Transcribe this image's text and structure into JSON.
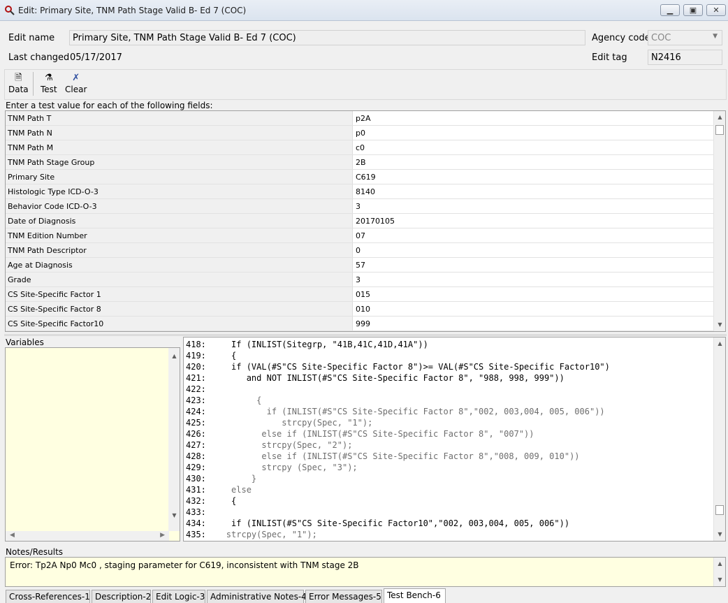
{
  "window": {
    "title": "Edit: Primary Site, TNM Path Stage Valid B- Ed 7 (COC)",
    "controls": [
      "minimize-icon",
      "maximize-icon",
      "close-icon"
    ]
  },
  "header": {
    "edit_name_label": "Edit name",
    "edit_name_value": "Primary Site, TNM Path Stage Valid B- Ed 7 (COC)",
    "agency_label": "Agency code",
    "agency_value": "COC",
    "last_changed_label": "Last changed",
    "last_changed_value": "05/17/2017",
    "edit_tag_label": "Edit tag",
    "edit_tag_value": "N2416"
  },
  "toolbar": {
    "data_label": "Data",
    "test_label": "Test",
    "clear_label": "Clear"
  },
  "prompt": "Enter a test value for each of the following fields:",
  "fields": [
    {
      "name": "TNM Path T",
      "value": "p2A"
    },
    {
      "name": "TNM Path N",
      "value": "p0"
    },
    {
      "name": "TNM Path M",
      "value": "c0"
    },
    {
      "name": "TNM Path Stage Group",
      "value": "2B"
    },
    {
      "name": "Primary Site",
      "value": "C619"
    },
    {
      "name": "Histologic Type ICD-O-3",
      "value": "8140"
    },
    {
      "name": "Behavior Code ICD-O-3",
      "value": "3"
    },
    {
      "name": "Date of Diagnosis",
      "value": "20170105"
    },
    {
      "name": "TNM Edition Number",
      "value": "07"
    },
    {
      "name": "TNM Path Descriptor",
      "value": "0"
    },
    {
      "name": "Age at Diagnosis",
      "value": "57"
    },
    {
      "name": "Grade",
      "value": "3"
    },
    {
      "name": "CS Site-Specific Factor 1",
      "value": "015"
    },
    {
      "name": "CS Site-Specific Factor 8",
      "value": "010"
    },
    {
      "name": "CS Site-Specific Factor10",
      "value": "999"
    }
  ],
  "variables_label": "Variables",
  "code": [
    {
      "num": "418:",
      "text": "     If (INLIST(Sitegrp, \"41B,41C,41D,41A\"))",
      "dim": false
    },
    {
      "num": "419:",
      "text": "     {",
      "dim": false
    },
    {
      "num": "420:",
      "text": "     if (VAL(#S\"CS Site-Specific Factor 8\")>= VAL(#S\"CS Site-Specific Factor10\")",
      "dim": false
    },
    {
      "num": "421:",
      "text": "        and NOT INLIST(#S\"CS Site-Specific Factor 8\", \"988, 998, 999\"))",
      "dim": false
    },
    {
      "num": "422:",
      "text": "",
      "dim": true
    },
    {
      "num": "423:",
      "text": "          {",
      "dim": true
    },
    {
      "num": "424:",
      "text": "            if (INLIST(#S\"CS Site-Specific Factor 8\",\"002, 003,004, 005, 006\"))",
      "dim": true
    },
    {
      "num": "425:",
      "text": "               strcpy(Spec, \"1\");",
      "dim": true
    },
    {
      "num": "426:",
      "text": "           else if (INLIST(#S\"CS Site-Specific Factor 8\", \"007\"))",
      "dim": true
    },
    {
      "num": "427:",
      "text": "           strcpy(Spec, \"2\");",
      "dim": true
    },
    {
      "num": "428:",
      "text": "           else if (INLIST(#S\"CS Site-Specific Factor 8\",\"008, 009, 010\"))",
      "dim": true
    },
    {
      "num": "429:",
      "text": "           strcpy (Spec, \"3\");",
      "dim": true
    },
    {
      "num": "430:",
      "text": "         }",
      "dim": true
    },
    {
      "num": "431:",
      "text": "     else",
      "dim": true
    },
    {
      "num": "432:",
      "text": "     {",
      "dim": false
    },
    {
      "num": "433:",
      "text": "",
      "dim": true
    },
    {
      "num": "434:",
      "text": "     if (INLIST(#S\"CS Site-Specific Factor10\",\"002, 003,004, 005, 006\"))",
      "dim": false
    },
    {
      "num": "435:",
      "text": "    strcpy(Spec, \"1\");",
      "dim": true
    }
  ],
  "notes_label": "Notes/Results",
  "notes_text": "Error: Tp2A  Np0   Mc0  , staging parameter for C619, inconsistent with TNM stage 2B",
  "tabs": [
    {
      "label": "Cross-References-1",
      "active": false
    },
    {
      "label": "Description-2",
      "active": false
    },
    {
      "label": "Edit Logic-3",
      "active": false
    },
    {
      "label": "Administrative Notes-4",
      "active": false
    },
    {
      "label": "Error Messages-5",
      "active": false
    },
    {
      "label": "Test Bench-6",
      "active": true
    }
  ]
}
